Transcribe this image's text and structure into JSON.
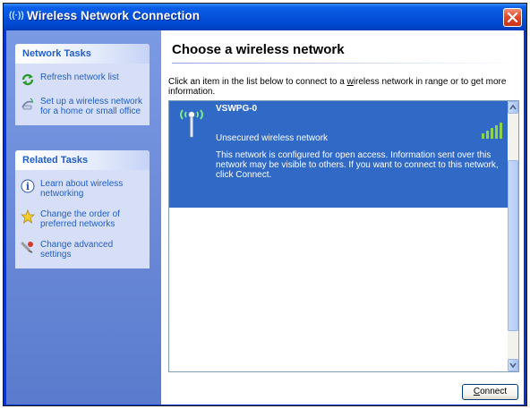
{
  "window": {
    "title": "Wireless Network Connection",
    "title_icon": "wireless-signal-icon",
    "close_icon": "close-icon"
  },
  "sidebar": {
    "network_tasks": {
      "header": "Network Tasks",
      "items": [
        {
          "label": "Refresh network list",
          "icon": "refresh-icon"
        },
        {
          "label": "Set up a wireless network for a home or small office",
          "icon": "setup-network-icon"
        }
      ]
    },
    "related_tasks": {
      "header": "Related Tasks",
      "items": [
        {
          "label": "Learn about wireless networking",
          "icon": "info-icon"
        },
        {
          "label": "Change the order of preferred networks",
          "icon": "star-icon"
        },
        {
          "label": "Change advanced settings",
          "icon": "settings-icon"
        }
      ]
    }
  },
  "main": {
    "title": "Choose a wireless network",
    "description_before": "Click an item in the list below to connect to a ",
    "description_accel": "w",
    "description_after": "ireless network in range or to get more information.",
    "networks": [
      {
        "name": "VSWPG-0",
        "security": "Unsecured wireless network",
        "details": "This network is configured for open access. Information sent over this network may be visible to others. If you want to connect to this network, click Connect.",
        "signal_icon": "wireless-antenna-icon",
        "strength_icon": "signal-strength-icon",
        "selected": true
      }
    ],
    "connect_accel": "C",
    "connect_rest": "onnect"
  },
  "colors": {
    "title_bar": "#0653dc",
    "selected_item": "#3169c6",
    "task_link": "#215dc6",
    "sidebar": "#6b8ad8"
  }
}
